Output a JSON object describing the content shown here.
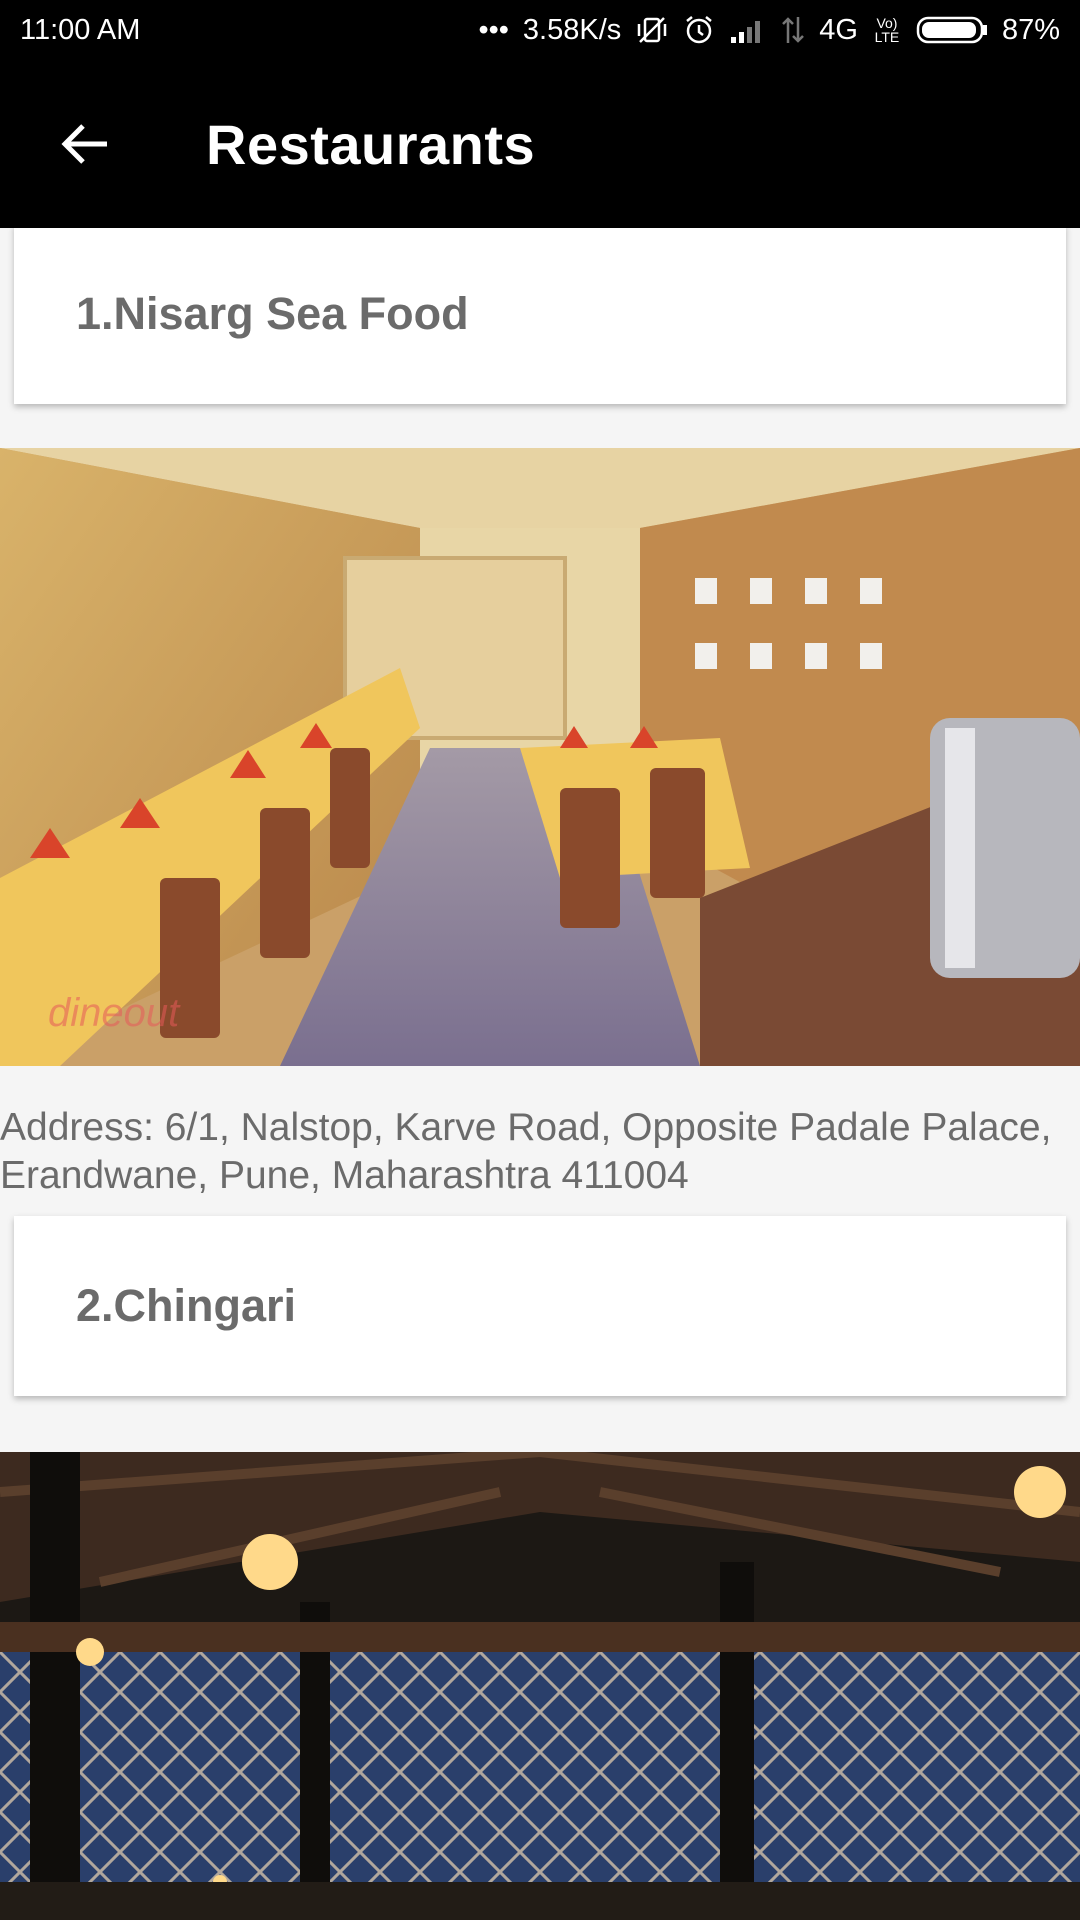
{
  "status_bar": {
    "time": "11:00 AM",
    "dots": "•••",
    "network_speed": "3.58K/s",
    "network_type": "4G",
    "volte": "Vo) LTE",
    "battery": "87%"
  },
  "app_bar": {
    "title": "Restaurants"
  },
  "restaurants": [
    {
      "title": "1.Nisarg Sea Food",
      "watermark": "dineout",
      "address": "Address: 6/1, Nalstop, Karve Road, Opposite Padale Palace, Erandwane, Pune, Maharashtra 411004"
    },
    {
      "title": "2.Chingari"
    }
  ],
  "colors": {
    "app_bar_bg": "#000000",
    "card_text": "#6b6b6b",
    "page_bg": "#f5f5f5"
  }
}
